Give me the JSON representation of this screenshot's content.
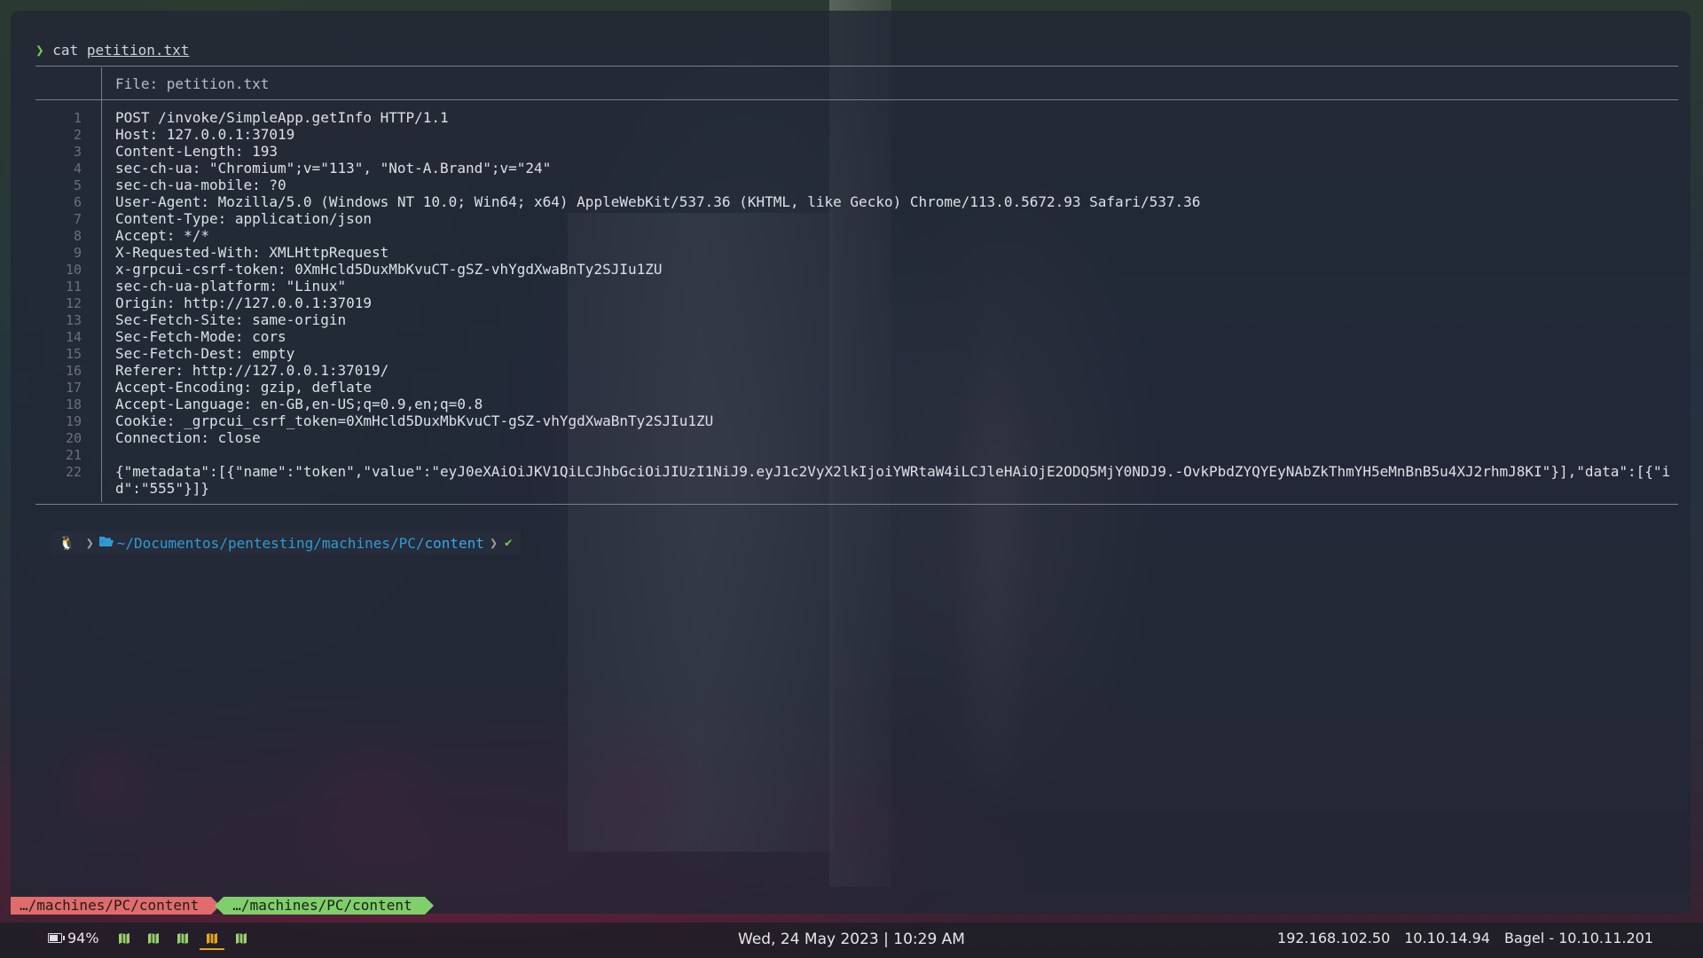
{
  "terminal": {
    "prompt_symbol": "❯",
    "command": "cat",
    "command_arg": "petition.txt",
    "file_header": "File: petition.txt",
    "line_numbers": [
      "1",
      "2",
      "3",
      "4",
      "5",
      "6",
      "7",
      "8",
      "9",
      "10",
      "11",
      "12",
      "13",
      "14",
      "15",
      "16",
      "17",
      "18",
      "19",
      "20",
      "21",
      "22"
    ],
    "lines": [
      "POST /invoke/SimpleApp.getInfo HTTP/1.1",
      "Host: 127.0.0.1:37019",
      "Content-Length: 193",
      "sec-ch-ua: \"Chromium\";v=\"113\", \"Not-A.Brand\";v=\"24\"",
      "sec-ch-ua-mobile: ?0",
      "User-Agent: Mozilla/5.0 (Windows NT 10.0; Win64; x64) AppleWebKit/537.36 (KHTML, like Gecko) Chrome/113.0.5672.93 Safari/537.36",
      "Content-Type: application/json",
      "Accept: */*",
      "X-Requested-With: XMLHttpRequest",
      "x-grpcui-csrf-token: 0XmHcld5DuxMbKvuCT-gSZ-vhYgdXwaBnTy2SJIu1ZU",
      "sec-ch-ua-platform: \"Linux\"",
      "Origin: http://127.0.0.1:37019",
      "Sec-Fetch-Site: same-origin",
      "Sec-Fetch-Mode: cors",
      "Sec-Fetch-Dest: empty",
      "Referer: http://127.0.0.1:37019/",
      "Accept-Encoding: gzip, deflate",
      "Accept-Language: en-GB,en-US;q=0.9,en;q=0.8",
      "Cookie: _grpcui_csrf_token=0XmHcld5DuxMbKvuCT-gSZ-vhYgdXwaBnTy2SJIu1ZU",
      "Connection: close",
      "",
      "{\"metadata\":[{\"name\":\"token\",\"value\":\"eyJ0eXAiOiJKV1QiLCJhbGciOiJIUzI1NiJ9.eyJ1c2VyX2lkIjoiYWRtaW4iLCJleHAiOjE2ODQ5MjY0NDJ9.-OvkPbdZYQYEyNAbZkThmYH5eMnBnB5u4XJ2rhmJ8KI\"}],\"data\":[{\"id\":\"555\"}]}"
    ]
  },
  "prompt": {
    "os_glyph": "🐧",
    "sep": "❯",
    "path_prefix": "~/Documentos/pentesting/machines/PC/",
    "path_last": "content",
    "status": "✔"
  },
  "tmux": {
    "tab1": "…/machines/PC/content",
    "tab2": "…/machines/PC/content"
  },
  "panel": {
    "battery": "94%",
    "battery_level": 0.94,
    "workspaces": [
      {
        "name": "ws-1",
        "active": false,
        "color": "#9bd16a"
      },
      {
        "name": "ws-2",
        "active": false,
        "color": "#9bd16a"
      },
      {
        "name": "ws-3",
        "active": false,
        "color": "#9bd16a"
      },
      {
        "name": "ws-4",
        "active": true,
        "color": "#e8a320"
      },
      {
        "name": "ws-5",
        "active": false,
        "color": "#9bd16a"
      }
    ],
    "clock": "Wed, 24 May 2023 | 10:29 AM",
    "local_ip": "192.168.102.50",
    "vpn_ip": "10.10.14.94",
    "target": "Bagel - 10.10.11.201"
  },
  "colors": {
    "accent_green": "#6fd14e",
    "path_blue": "#2f9bd6",
    "tab_red": "#e26b6b",
    "tab_green": "#7fcf6a",
    "active_workspace": "#e8a320"
  }
}
